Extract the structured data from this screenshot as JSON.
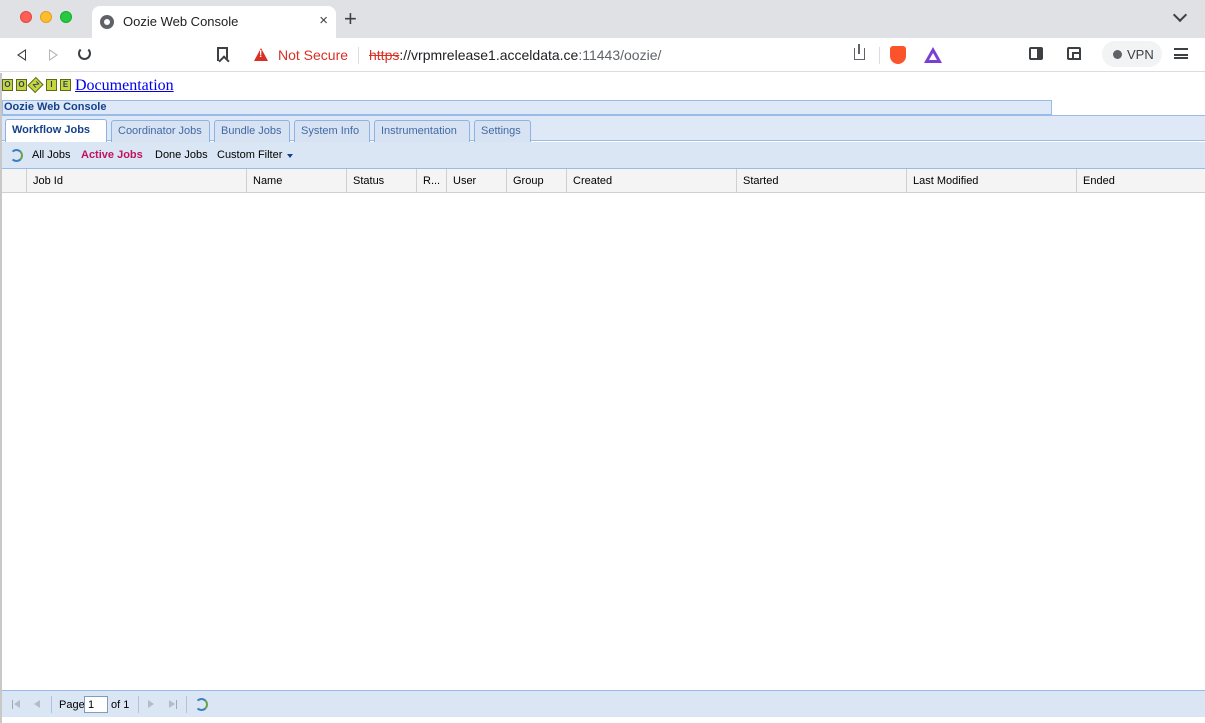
{
  "browser": {
    "tab_title": "Oozie Web Console",
    "tab_close": "×",
    "new_tab": "+",
    "security_label": "Not Secure",
    "url_scheme": "https",
    "url_host": "://vrpmrelease1.acceldata.ce",
    "url_rest": ":11443/oozie/",
    "vpn_label": "VPN"
  },
  "header": {
    "logo_letters": [
      "O",
      "O",
      "Z",
      "I",
      "E"
    ],
    "documentation_link": "Documentation",
    "console_title": "Oozie Web Console"
  },
  "tabs": [
    {
      "label": "Workflow Jobs",
      "active": true
    },
    {
      "label": "Coordinator Jobs",
      "active": false
    },
    {
      "label": "Bundle Jobs",
      "active": false
    },
    {
      "label": "System Info",
      "active": false
    },
    {
      "label": "Instrumentation",
      "active": false
    },
    {
      "label": "Settings",
      "active": false
    }
  ],
  "job_toolbar": {
    "all_jobs": "All Jobs",
    "active_jobs": "Active Jobs",
    "done_jobs": "Done Jobs",
    "custom_filter": "Custom Filter"
  },
  "grid": {
    "columns": [
      "Job Id",
      "Name",
      "Status",
      "R...",
      "User",
      "Group",
      "Created",
      "Started",
      "Last Modified",
      "Ended"
    ],
    "rows": []
  },
  "paging": {
    "page_label": "Page",
    "page_value": "1",
    "of_label": "of 1"
  },
  "colors": {
    "accent": "#15428b",
    "active_filter": "#c0135c",
    "panel_bg": "#dfe8f6",
    "warning": "#d93025"
  }
}
